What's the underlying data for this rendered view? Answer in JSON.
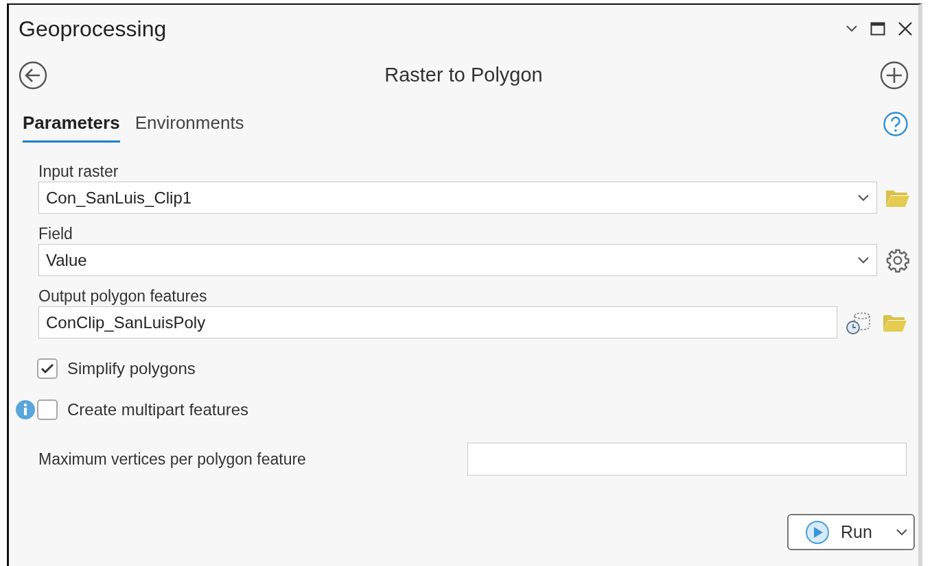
{
  "window": {
    "title": "Geoprocessing"
  },
  "tool": {
    "title": "Raster to Polygon"
  },
  "tabs": [
    {
      "label": "Parameters",
      "selected": true
    },
    {
      "label": "Environments",
      "selected": false
    }
  ],
  "parameters": [
    {
      "kind": "dataset_dropdown",
      "label": "Input raster",
      "value": "Con_SanLuis_Clip1"
    },
    {
      "kind": "field_dropdown",
      "label": "Field",
      "value": "Value"
    },
    {
      "kind": "output_text",
      "label": "Output polygon features",
      "value": "ConClip_SanLuisPoly"
    },
    {
      "kind": "checkbox",
      "label": "Simplify polygons",
      "checked": true,
      "info": false
    },
    {
      "kind": "checkbox",
      "label": "Create multipart features",
      "checked": false,
      "info": true
    },
    {
      "kind": "inline_text",
      "label": "Maximum vertices per polygon feature"
    }
  ],
  "run_button": {
    "label": "Run"
  }
}
